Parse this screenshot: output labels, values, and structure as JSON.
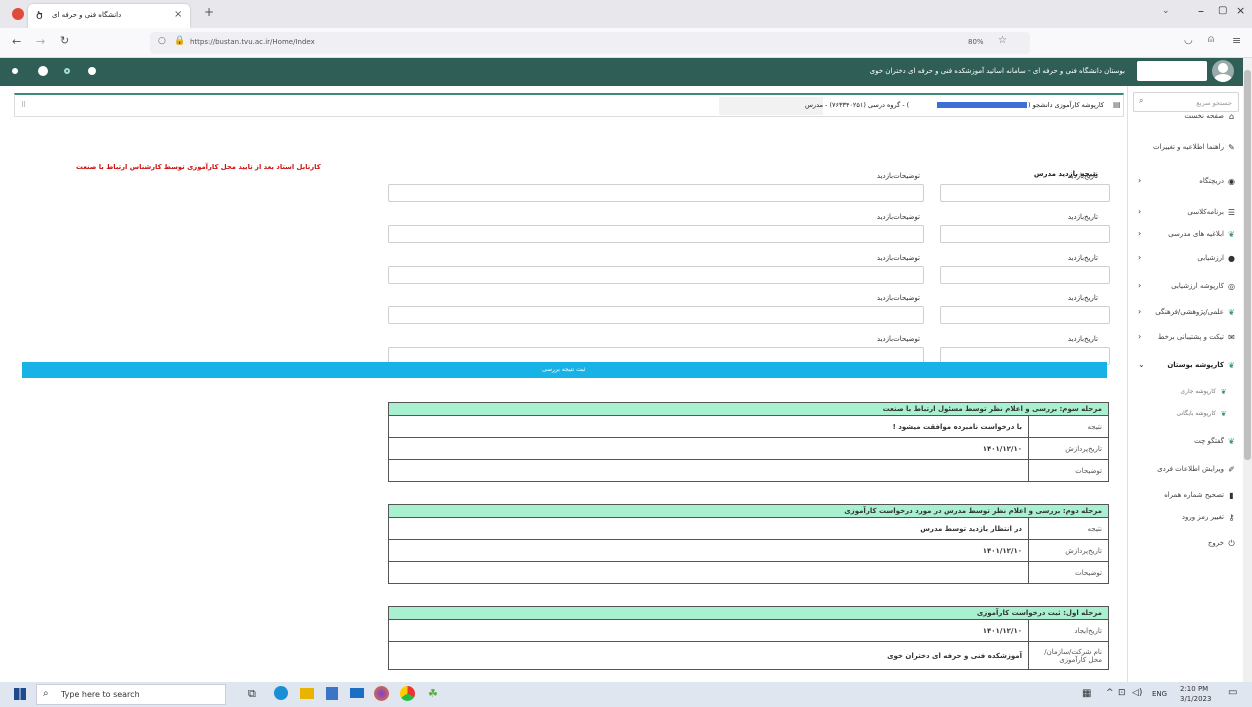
{
  "browser": {
    "tab_title": "دانشگاه فنی و حرفه ای",
    "url": "https://bustan.tvu.ac.ir/Home/Index",
    "zoom": "80%",
    "new_tab": "+",
    "close_tab": "×"
  },
  "header": {
    "title": "بوستان دانشگاه فنی و حرفه ای - سامانه اساتید آموزشکده فنی و حرفه ای دختران خوی"
  },
  "sidebar": {
    "search_placeholder": "جستجو سریع",
    "items": [
      {
        "label": "صفحه نخست",
        "icon": "home-icon",
        "chevron": false
      },
      {
        "label": "راهنما اطلاعیه و تغییرات",
        "icon": "guide-icon",
        "chevron": false
      },
      {
        "label": "دریچتگاه",
        "icon": "eye-icon",
        "chevron": true
      },
      {
        "label": "برنامه‌کلاسی",
        "icon": "list-icon",
        "chevron": true
      },
      {
        "label": "ابلاغیه های مدرسی",
        "icon": "leaf-icon",
        "chevron": true
      },
      {
        "label": "ارزشیابی",
        "icon": "comment-icon",
        "chevron": true
      },
      {
        "label": "کارپوشه ارزشیابی",
        "icon": "globe-icon",
        "chevron": true
      },
      {
        "label": "علمی/پژوهشی/فرهنگی",
        "icon": "leaf-icon",
        "chevron": true
      },
      {
        "label": "تیکت و پشتیبانی برخط",
        "icon": "chat-icon",
        "chevron": true
      },
      {
        "label": "کارپوشه بوستان",
        "icon": "leaf-icon",
        "chevron": true,
        "open": true
      },
      {
        "label": "کارپوشه جاری",
        "icon": "leaf-icon",
        "chevron": false,
        "sub": true
      },
      {
        "label": "کارپوشه بایگانی",
        "icon": "leaf-icon",
        "chevron": false,
        "sub": true
      },
      {
        "label": "گفتگو چت",
        "icon": "leaf-icon",
        "chevron": false
      },
      {
        "label": "ویرایش اطلاعات فردی",
        "icon": "edit-icon",
        "chevron": false
      },
      {
        "label": "تصحیح شماره همراه",
        "icon": "phone-icon",
        "chevron": false
      },
      {
        "label": "تغییر رمز ورود",
        "icon": "key-icon",
        "chevron": false
      },
      {
        "label": "خروج",
        "icon": "power-icon",
        "chevron": false
      }
    ]
  },
  "main": {
    "breadcrumb_a": "کارپوشه کارآموزی دانشجو (",
    "breadcrumb_b": ") - گروه درسی (۷۶۳۳۴۰۲۵۱) - مدرس",
    "section_title": "نتیجه بازدید مدرس",
    "note": "کارتابل استاد بعد از تایید محل کارآموزی توسط کارشناس ارتباط با صنعت",
    "visit_date_label": "تاریخ‌بازدید",
    "visit_desc_label": "توضیحات‌بازدید",
    "submit_label": "ثبت نتیجه بررسی"
  },
  "stages": [
    {
      "title": "مرحله سوم: بررسی و اعلام نظر توسط مسئول ارتباط با صنعت",
      "rows": [
        {
          "label": "نتیجه",
          "value": "با درخواست نامبرده موافقت میشود !"
        },
        {
          "label": "تاریخ‌پردازش",
          "value": "۱۴۰۱/۱۲/۱۰"
        },
        {
          "label": "توضیحات",
          "value": ""
        }
      ]
    },
    {
      "title": "مرحله دوم: بررسی و اعلام نظر توسط مدرس در مورد درخواست کارآموزی",
      "rows": [
        {
          "label": "نتیجه",
          "value": "در انتظار بازدید توسط مدرس"
        },
        {
          "label": "تاریخ‌پردازش",
          "value": "۱۴۰۱/۱۲/۱۰"
        },
        {
          "label": "توضیحات",
          "value": ""
        }
      ]
    },
    {
      "title": "مرحله اول: ثبت درخواست کارآموزی",
      "rows": [
        {
          "label": "تاریخ‌ایجاد",
          "value": "۱۴۰۱/۱۲/۱۰"
        },
        {
          "label": "نام شرکت/سازمان/محل کارآموزی",
          "value": "آموزشکده فنی و حرفه ای دختران خوی"
        }
      ]
    }
  ],
  "taskbar": {
    "search_placeholder": "Type here to search",
    "lang": "ENG",
    "time": "2:10 PM",
    "date": "3/1/2023"
  },
  "colors": {
    "header": "#2e5e55",
    "stage_header": "#a8f0d0",
    "submit": "#17b3e6",
    "note": "#d01010",
    "redacted": "#3d6fd6"
  }
}
